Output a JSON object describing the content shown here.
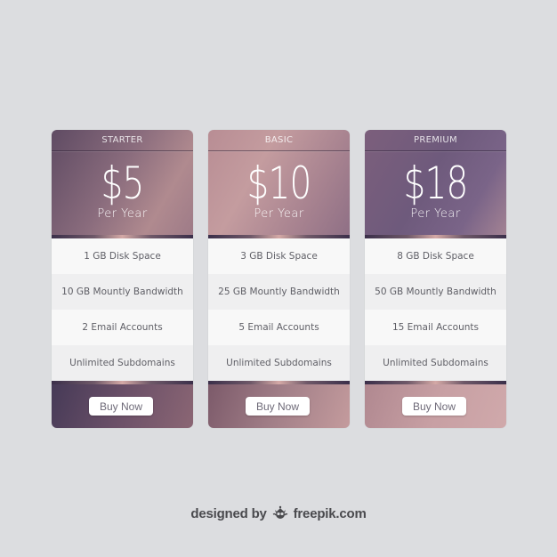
{
  "plans": [
    {
      "name": "STARTER",
      "price": "$5",
      "period": "Per Year",
      "features": [
        "1 GB Disk Space",
        "10 GB Mountly Bandwidth",
        "2 Email Accounts",
        "Unlimited Subdomains"
      ],
      "button_label": "Buy Now"
    },
    {
      "name": "BASIC",
      "price": "$10",
      "period": "Per Year",
      "features": [
        "3 GB Disk Space",
        "25 GB Mountly Bandwidth",
        "5 Email Accounts",
        "Unlimited Subdomains"
      ],
      "button_label": "Buy Now"
    },
    {
      "name": "PREMIUM",
      "price": "$18",
      "period": "Per Year",
      "features": [
        "8 GB Disk Space",
        "50 GB Mountly Bandwidth",
        "15 Email Accounts",
        "Unlimited Subdomains"
      ],
      "button_label": "Buy Now"
    }
  ],
  "footer": {
    "prefix": "designed by",
    "logo_icon": "freepik-logo-icon",
    "brand": "freepik.com"
  },
  "colors": {
    "background": "#dcdde0",
    "feature_text": "#5f5f66",
    "footer_text": "#4a4a4e"
  }
}
